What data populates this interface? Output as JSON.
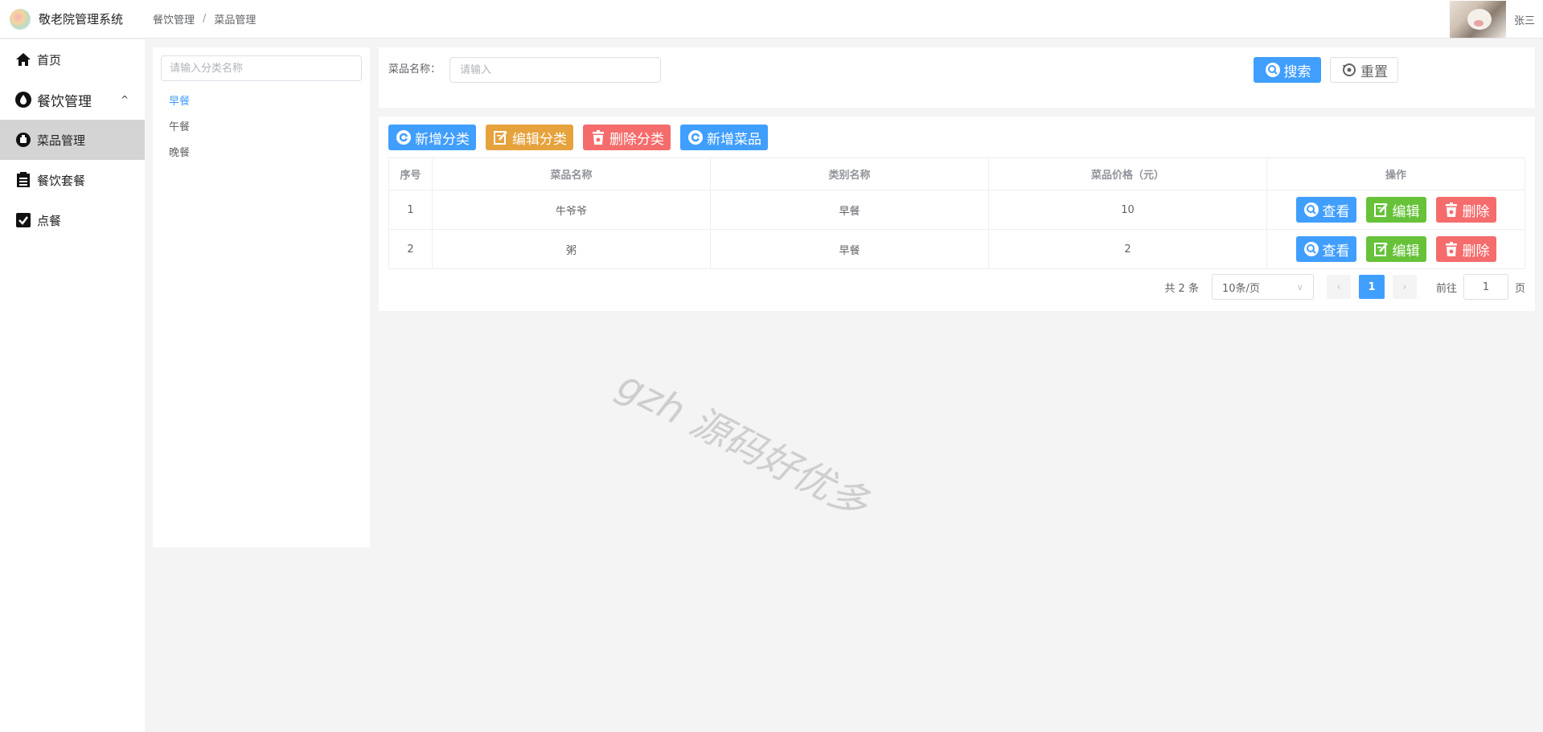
{
  "app": {
    "title": "敬老院管理系统",
    "user": "张三"
  },
  "breadcrumb": [
    "餐饮管理",
    "菜品管理"
  ],
  "sidebar": {
    "items": [
      {
        "label": "首页",
        "icon": "home-icon"
      },
      {
        "label": "餐饮管理",
        "icon": "drop-icon",
        "expanded": true
      },
      {
        "label": "菜品管理",
        "icon": "dish-icon",
        "active": true
      },
      {
        "label": "餐饮套餐",
        "icon": "clipboard-icon"
      },
      {
        "label": "点餐",
        "icon": "checkbox-icon"
      }
    ]
  },
  "category_panel": {
    "placeholder": "请输入分类名称",
    "items": [
      {
        "label": "早餐",
        "selected": true
      },
      {
        "label": "午餐"
      },
      {
        "label": "晚餐"
      }
    ]
  },
  "search": {
    "label": "菜品名称：",
    "placeholder": "请输入",
    "search_label": "搜索",
    "reset_label": "重置"
  },
  "toolbar": {
    "add_category": "新增分类",
    "edit_category": "编辑分类",
    "delete_category": "删除分类",
    "add_dish": "新增菜品"
  },
  "table": {
    "columns": [
      "序号",
      "菜品名称",
      "类别名称",
      "菜品价格（元）",
      "操作"
    ],
    "rows": [
      {
        "index": "1",
        "name": "牛爷爷",
        "category": "早餐",
        "price": "10"
      },
      {
        "index": "2",
        "name": "粥",
        "category": "早餐",
        "price": "2"
      }
    ],
    "actions": {
      "view": "查看",
      "edit": "编辑",
      "delete": "删除"
    }
  },
  "pagination": {
    "total": "共 2 条",
    "page_size": "10条/页",
    "current_page": "1",
    "goto_label": "前往",
    "goto_value": "1",
    "page_suffix": "页"
  },
  "watermark": "gzh 源码好优多",
  "colors": {
    "primary": "#409eff",
    "warning": "#e6a23c",
    "danger": "#f56c6c",
    "success": "#67c23a"
  }
}
